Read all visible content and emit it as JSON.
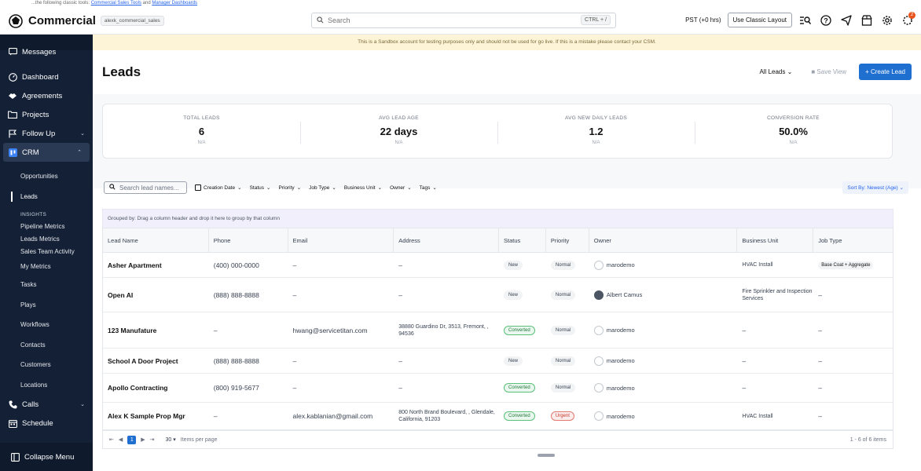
{
  "topstrip": {
    "prefix": "...the following classic tools:",
    "link1": "Commercial Sales Tools",
    "middle": "and",
    "link2": "Manager Dashboards"
  },
  "header": {
    "brand": "Commercial",
    "account": "alexk_commercial_sales",
    "search_placeholder": "Search",
    "search_shortcut": "CTRL + /",
    "timezone": "PST (+0 hrs)",
    "classic_label": "Use Classic Layout",
    "notification_count": "2"
  },
  "banner": "This is a Sandbox account for testing purposes only and should not be used for go live. If this is a mistake please contact your CSM.",
  "sidebar": {
    "messages": "Messages",
    "dashboard": "Dashboard",
    "agreements": "Agreements",
    "projects": "Projects",
    "follow_up": "Follow Up",
    "crm": "CRM",
    "opportunities": "Opportunities",
    "leads": "Leads",
    "insights": "INSIGHTS",
    "pipeline_metrics": "Pipeline Metrics",
    "leads_metrics": "Leads Metrics",
    "sales_team_activity": "Sales Team Activity",
    "my_metrics": "My Metrics",
    "tasks": "Tasks",
    "plays": "Plays",
    "workflows": "Workflows",
    "contacts": "Contacts",
    "customers": "Customers",
    "locations": "Locations",
    "calls": "Calls",
    "schedule": "Schedule",
    "collapse": "Collapse Menu"
  },
  "page": {
    "title": "Leads",
    "view_select": "All Leads",
    "save_view": "Save View",
    "create_lead": "+ Create Lead"
  },
  "kpis": [
    {
      "label": "TOTAL LEADS",
      "value": "6",
      "sub": "N/A"
    },
    {
      "label": "AVG LEAD AGE",
      "value": "22 days",
      "sub": "N/A"
    },
    {
      "label": "AVG NEW DAILY LEADS",
      "value": "1.2",
      "sub": "N/A"
    },
    {
      "label": "CONVERSION RATE",
      "value": "50.0%",
      "sub": "N/A"
    }
  ],
  "filters": {
    "search_placeholder": "Search lead names...",
    "creation_date": "Creation Date",
    "status": "Status",
    "priority": "Priority",
    "job_type": "Job Type",
    "business_unit": "Business Unit",
    "owner": "Owner",
    "tags": "Tags",
    "sort_by": "Sort By: Newest (Age)"
  },
  "grid": {
    "group_hint": "Grouped by:  Drag a column header and drop it here to group by that column",
    "columns": [
      "Lead Name",
      "Phone",
      "Email",
      "Address",
      "Status",
      "Priority",
      "Owner",
      "Business Unit",
      "Job Type"
    ],
    "rows": [
      {
        "name": "Asher Apartment",
        "phone": "(400) 000-0000",
        "email": "–",
        "address": "–",
        "status": "New",
        "priority": "Normal",
        "owner": "marodemo",
        "business_unit": "HVAC Install",
        "job_type": "Base Coat + Aggregate"
      },
      {
        "name": "Open AI",
        "phone": "(888) 888-8888",
        "email": "–",
        "address": "–",
        "status": "New",
        "priority": "Normal",
        "owner": "Albert Camus",
        "business_unit": "Fire Sprinkler and Inspection Services",
        "job_type": "–"
      },
      {
        "name": "123 Manufature",
        "phone": "–",
        "email": "hwang@servicetitan.com",
        "address": "38880 Guardino Dr, 3513, Fremont, , 94536",
        "status": "Converted",
        "priority": "Normal",
        "owner": "marodemo",
        "business_unit": "–",
        "job_type": "–"
      },
      {
        "name": "School A Door Project",
        "phone": "(888) 888-8888",
        "email": "–",
        "address": "–",
        "status": "New",
        "priority": "Normal",
        "owner": "marodemo",
        "business_unit": "–",
        "job_type": "–"
      },
      {
        "name": "Apollo Contracting",
        "phone": "(800) 919-5677",
        "email": "–",
        "address": "–",
        "status": "Converted",
        "priority": "Normal",
        "owner": "marodemo",
        "business_unit": "–",
        "job_type": "–"
      },
      {
        "name": "Alex K Sample Prop Mgr",
        "phone": "–",
        "email": "alex.kablanian@gmail.com",
        "address": "800 North Brand Boulevard, , Glendale, California, 91203",
        "status": "Converted",
        "priority": "Urgent",
        "owner": "marodemo",
        "business_unit": "HVAC Install",
        "job_type": "–"
      }
    ]
  },
  "pager": {
    "page": "1",
    "page_size": "30",
    "items_per_page": "Items per page",
    "count": "1 - 6 of 6 items"
  }
}
